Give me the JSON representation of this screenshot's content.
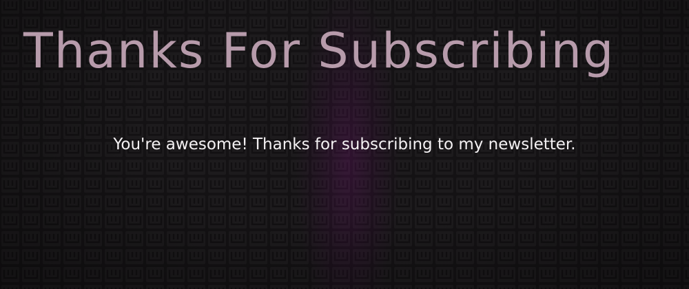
{
  "header": {
    "title": "Thanks For Subscribing"
  },
  "main": {
    "message": "You're awesome! Thanks for subscribing to my newsletter."
  },
  "colors": {
    "background": "#151315",
    "title": "#b79bab",
    "text": "#f4f1f3",
    "tile": "#1f1d1f",
    "glow": "#5a1a5c"
  }
}
